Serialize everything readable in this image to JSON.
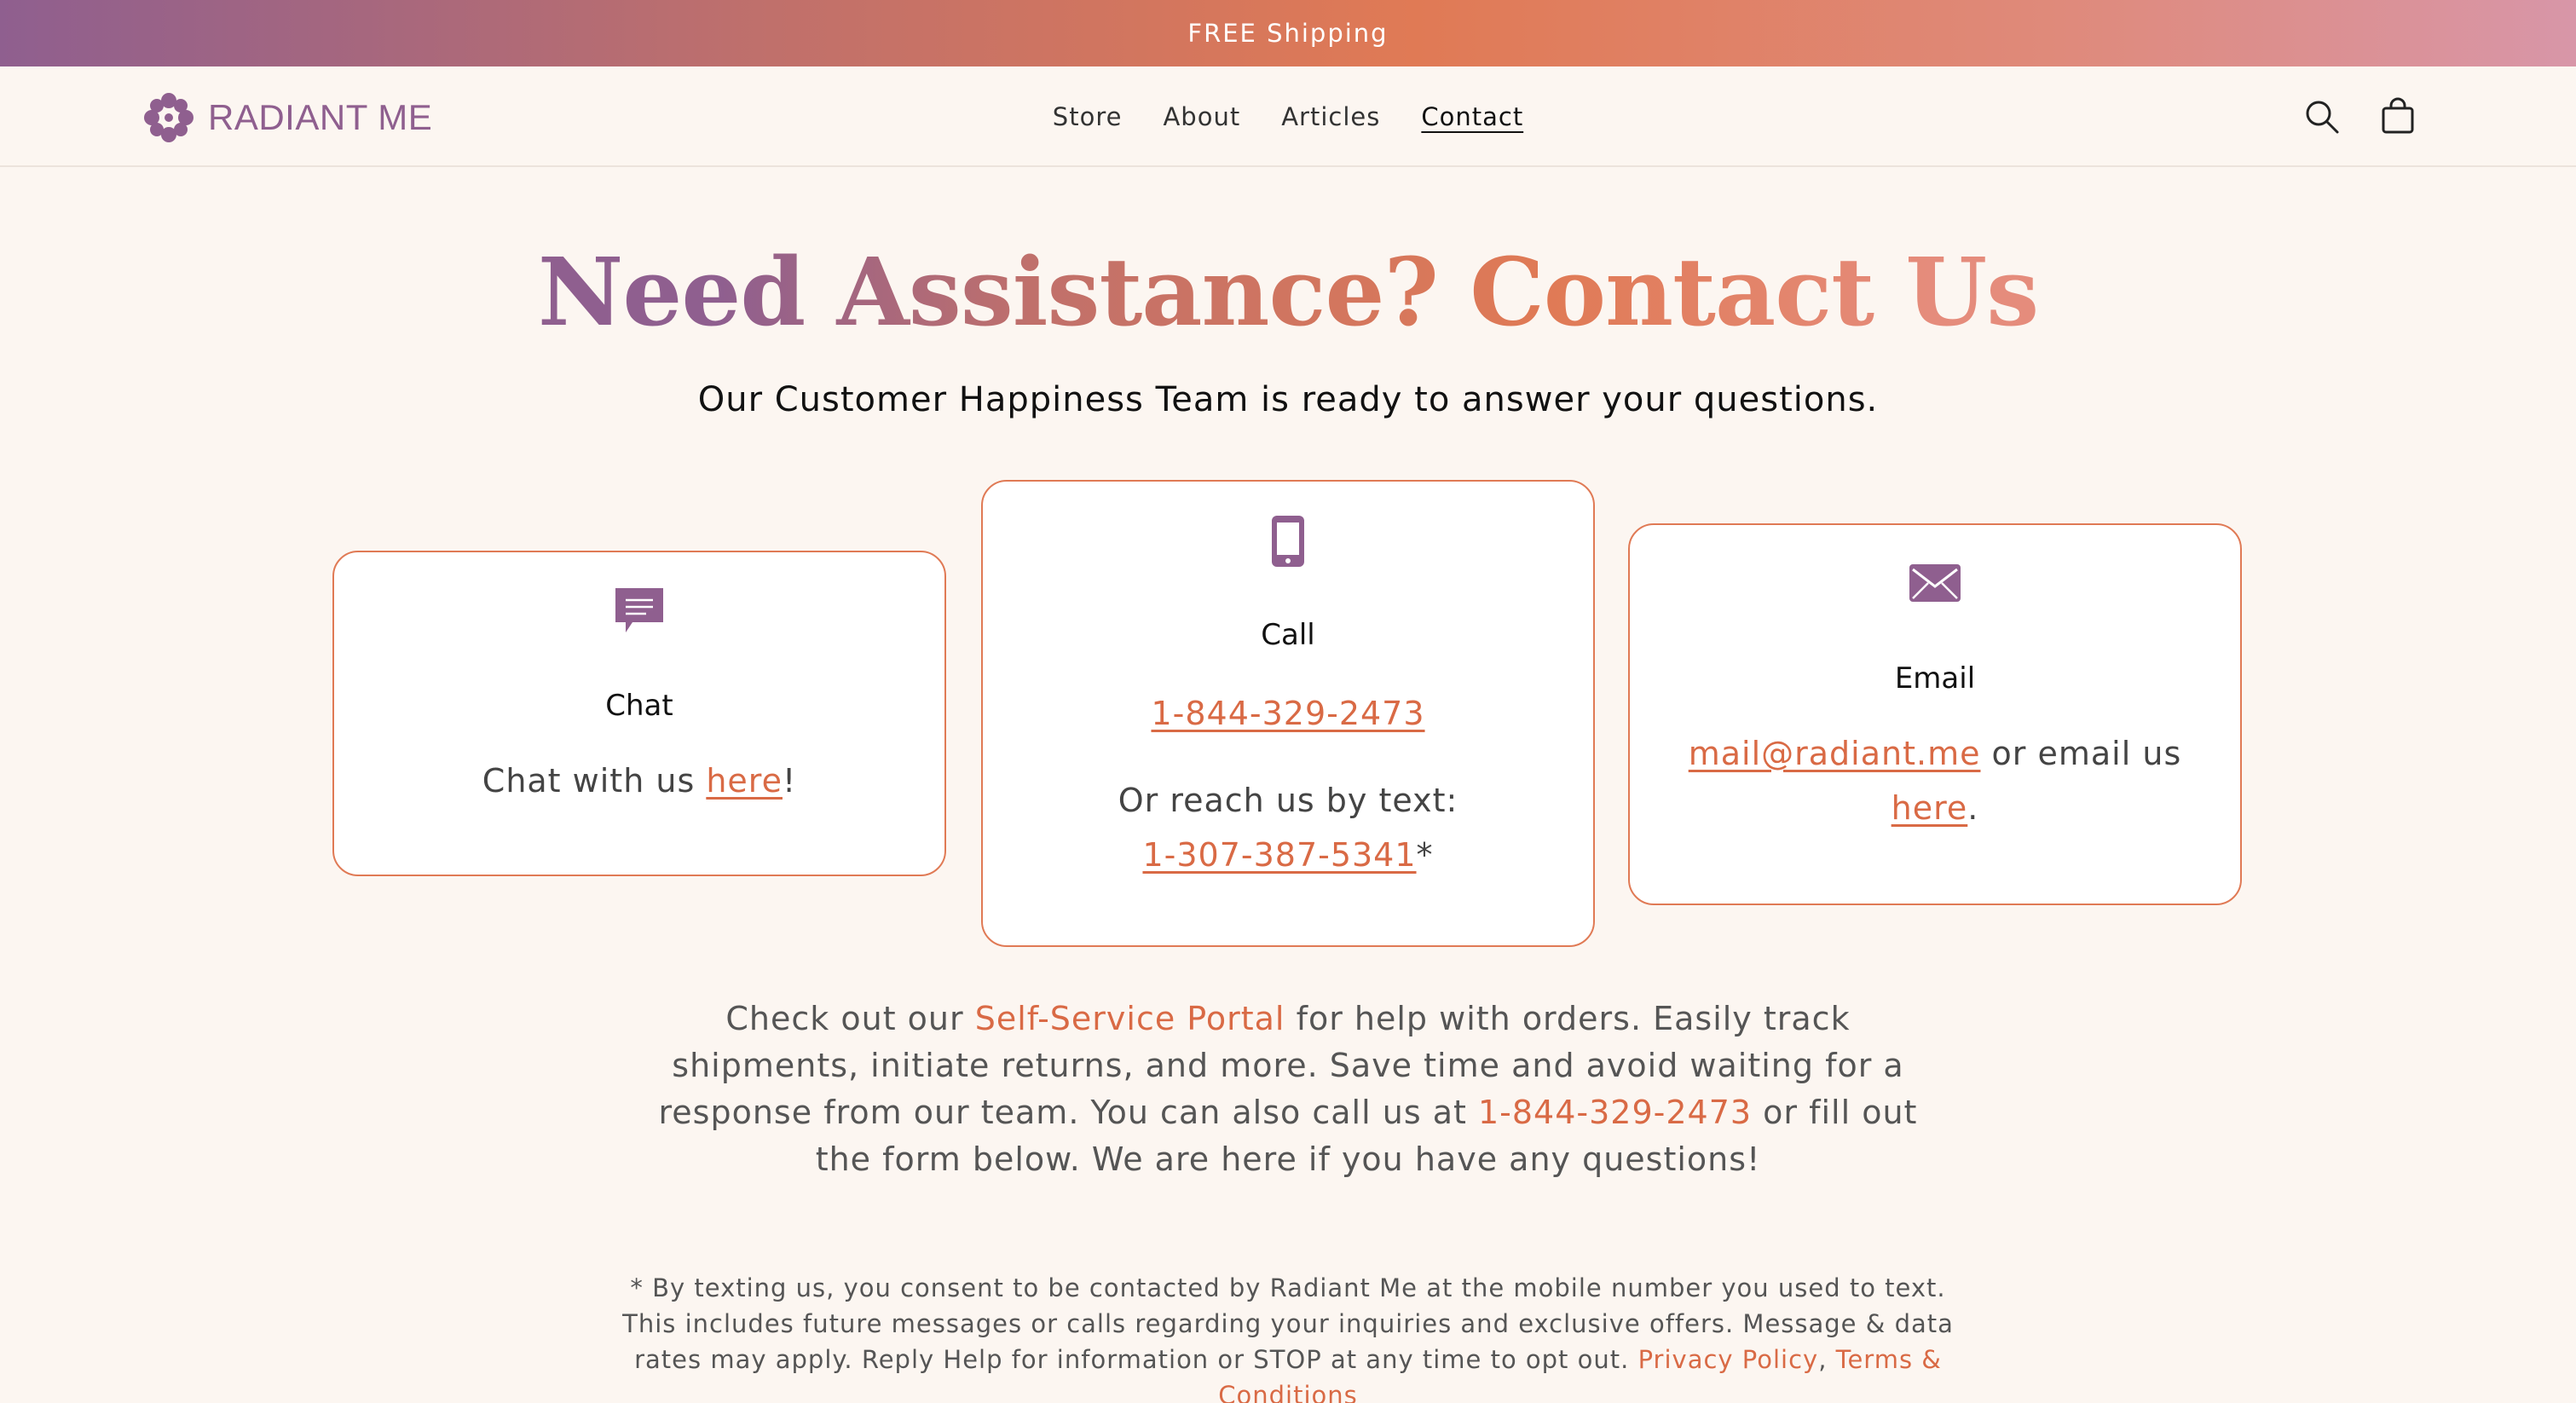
{
  "announcement": {
    "text": "FREE Shipping"
  },
  "header": {
    "brand": "RADIANT ME",
    "nav": [
      {
        "label": "Store"
      },
      {
        "label": "About"
      },
      {
        "label": "Articles"
      },
      {
        "label": "Contact",
        "active": true
      }
    ],
    "icons": [
      "search-icon",
      "cart-icon"
    ]
  },
  "hero": {
    "title": "Need Assistance? Contact Us",
    "subtitle": "Our Customer Happiness Team is ready to answer your questions."
  },
  "cards": {
    "chat": {
      "icon": "chat-bubble-icon",
      "title": "Chat",
      "text_before": "Chat with us ",
      "link": "here",
      "text_after": "!"
    },
    "call": {
      "icon": "mobile-phone-icon",
      "title": "Call",
      "phone": "1-844-329-2473",
      "text_label": "Or reach us by text:",
      "text_phone": "1-307-387-5341",
      "text_suffix": "*"
    },
    "email": {
      "icon": "envelope-icon",
      "title": "Email",
      "address": "mail@radiant.me",
      "middle": " or email us",
      "link": "here",
      "suffix": "."
    }
  },
  "portal": {
    "p1": "Check out our ",
    "portal_link": "Self-Service Portal",
    "p2": " for help with orders. Easily track shipments, initiate returns, and more. Save time and avoid waiting for a response from our team. You can also call us at ",
    "phone_link": "1-844-329-2473",
    "p3": " or fill out the form below. We are here if you have any questions!"
  },
  "disclaimer": {
    "text": "* By texting us, you consent to be contacted by Radiant Me at the mobile number you used to text. This includes future messages or calls regarding your inquiries and exclusive offers. Message & data rates may apply. Reply Help for information or STOP at any time to opt out. ",
    "privacy_link": "Privacy Policy",
    "sep": ", ",
    "terms_link": "Terms & Conditions"
  },
  "colors": {
    "accent": "#e07a55",
    "brand_purple": "#8f5f8f",
    "background": "#fcf6f1"
  }
}
